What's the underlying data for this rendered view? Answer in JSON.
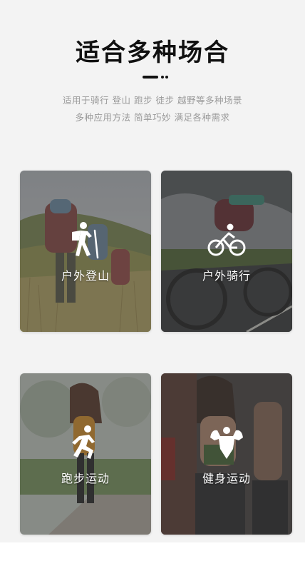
{
  "header": {
    "title": "适合多种场合",
    "subtitle_line1": "适用于骑行 登山 跑步 徒步 越野等多种场景",
    "subtitle_line2": "多种应用方法 简单巧妙 满足各种需求"
  },
  "scenarios": [
    {
      "label": "户外登山",
      "icon": "hiking-icon"
    },
    {
      "label": "户外骑行",
      "icon": "cycling-icon"
    },
    {
      "label": "跑步运动",
      "icon": "running-icon"
    },
    {
      "label": "健身运动",
      "icon": "fitness-icon"
    }
  ],
  "colors": {
    "background": "#f3f3f3",
    "title": "#111111",
    "subtitle": "#9a9a9a",
    "label": "#ffffff"
  }
}
